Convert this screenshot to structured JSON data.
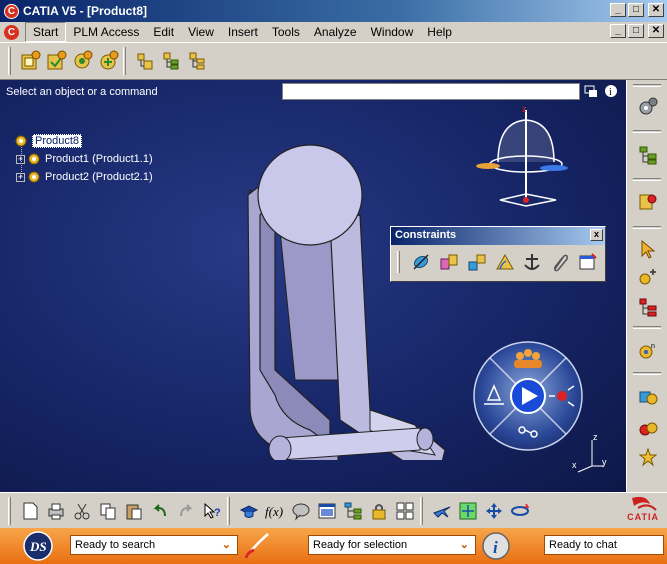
{
  "window": {
    "title": "CATIA V5 - [Product8]",
    "app_letter": "C"
  },
  "window_controls": {
    "minimize": "_",
    "restore": "□",
    "close": "✕"
  },
  "menubar": {
    "items": [
      {
        "label": "Start"
      },
      {
        "label": "PLM Access"
      },
      {
        "label": "Edit"
      },
      {
        "label": "View"
      },
      {
        "label": "Insert"
      },
      {
        "label": "Tools"
      },
      {
        "label": "Analyze"
      },
      {
        "label": "Window"
      },
      {
        "label": "Help"
      }
    ]
  },
  "viewport": {
    "prompt": "Select an object or a command",
    "command_input": {
      "value": "",
      "placeholder": ""
    },
    "axis_labels": {
      "x": "x",
      "y": "y",
      "z": "z"
    }
  },
  "tree": {
    "root": "Product8",
    "children": [
      {
        "label": "Product1 (Product1.1)"
      },
      {
        "label": "Product2 (Product2.1)"
      }
    ]
  },
  "constraints_toolbar": {
    "title": "Constraints",
    "close": "x"
  },
  "statusbar": {
    "search": "Ready to search",
    "selection": "Ready for selection",
    "chat": "Ready to chat"
  },
  "branding": {
    "logo_text": "CATIA"
  },
  "colors": {
    "title_bar": "#0a246a",
    "viewport_bg": "#162566",
    "status_orange": "#e86f12",
    "part_color": "#b3b0d6"
  }
}
